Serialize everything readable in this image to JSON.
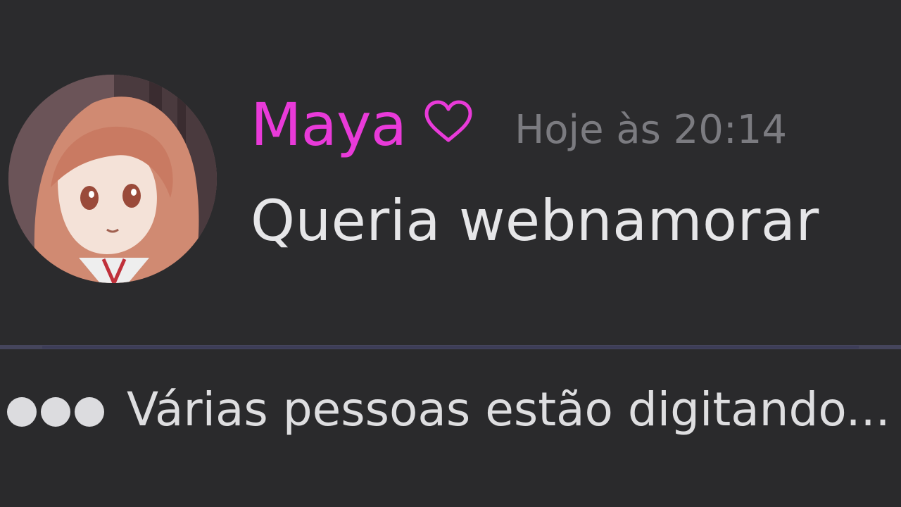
{
  "message": {
    "username": "Maya",
    "username_color": "#e93ad9",
    "badge_icon": "heart-outline-icon",
    "timestamp": "Hoje às 20:14",
    "content": "Queria webnamorar"
  },
  "typing_indicator": {
    "text": "Várias pessoas estão digitando..."
  },
  "colors": {
    "background": "#2b2b2d",
    "timestamp": "#7b7b80",
    "message_text": "#e6e6e8"
  }
}
